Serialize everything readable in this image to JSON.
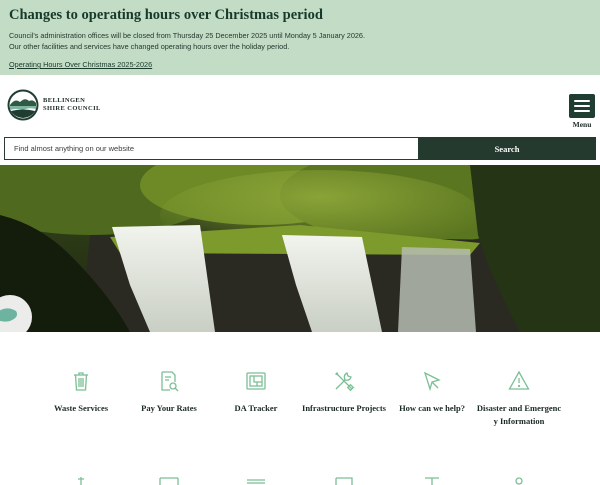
{
  "notice": {
    "title": "Changes to operating hours over Christmas period",
    "line1": "Council's administration offices will be closed from Thursday 25 December 2025 until Monday 5 January 2026.",
    "line2": "Our other facilities and services have changed operating hours over the holiday period.",
    "link": "Operating Hours Over Christmas 2025-2026"
  },
  "header": {
    "logo_line1": "BELLINGEN",
    "logo_line2": "SHIRE COUNCIL",
    "menu_label": "Menu"
  },
  "search": {
    "placeholder": "Find almost anything on our website",
    "button_label": "Search"
  },
  "quick_links": [
    {
      "label": "Waste Services",
      "icon": "trash-icon"
    },
    {
      "label": "Pay Your Rates",
      "icon": "document-search-icon"
    },
    {
      "label": "DA Tracker",
      "icon": "plan-icon"
    },
    {
      "label": "Infrastructure Projects",
      "icon": "tools-icon"
    },
    {
      "label": "How can we help?",
      "icon": "cursor-icon"
    },
    {
      "label": "Disaster and Emergency Information",
      "icon": "warning-icon"
    }
  ],
  "colors": {
    "banner": "#c3dcc6",
    "brand_dark": "#243a2f",
    "icon_green": "#7bbf95"
  }
}
